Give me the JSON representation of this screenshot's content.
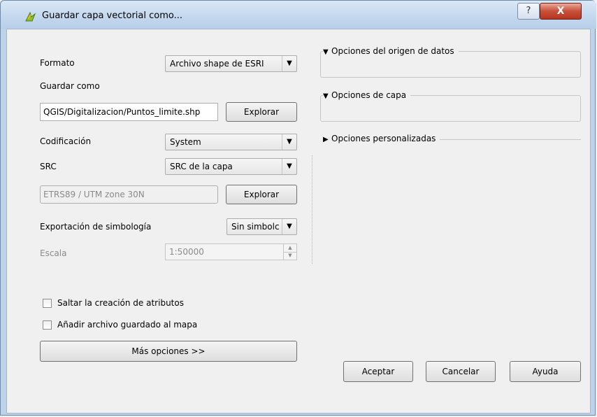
{
  "window": {
    "title": "Guardar capa vectorial como...",
    "help_glyph": "?",
    "close_glyph": "X"
  },
  "form": {
    "formato_label": "Formato",
    "formato_value": "Archivo shape de ESRI",
    "guardar_como_label": "Guardar como",
    "guardar_como_value": "QGIS/Digitalizacion/Puntos_limite.shp",
    "explorar_label": "Explorar",
    "codificacion_label": "Codificación",
    "codificacion_value": "System",
    "src_label": "SRC",
    "src_value": "SRC de la capa",
    "crs_value": "ETRS89 / UTM zone 30N",
    "explorar2_label": "Explorar",
    "simbologia_label": "Exportación de simbología",
    "simbologia_value": "Sin simbolc",
    "escala_label": "Escala",
    "escala_value": "1:50000",
    "skip_attrs_label": "Saltar la creación de atributos",
    "add_to_map_label": "Añadir archivo guardado al mapa",
    "more_options_label": "Más opciones >>"
  },
  "groups": {
    "datasource": "Opciones del origen de datos",
    "layer": "Opciones de capa",
    "custom": "Opciones personalizadas"
  },
  "buttons": {
    "ok": "Aceptar",
    "cancel": "Cancelar",
    "help": "Ayuda"
  }
}
